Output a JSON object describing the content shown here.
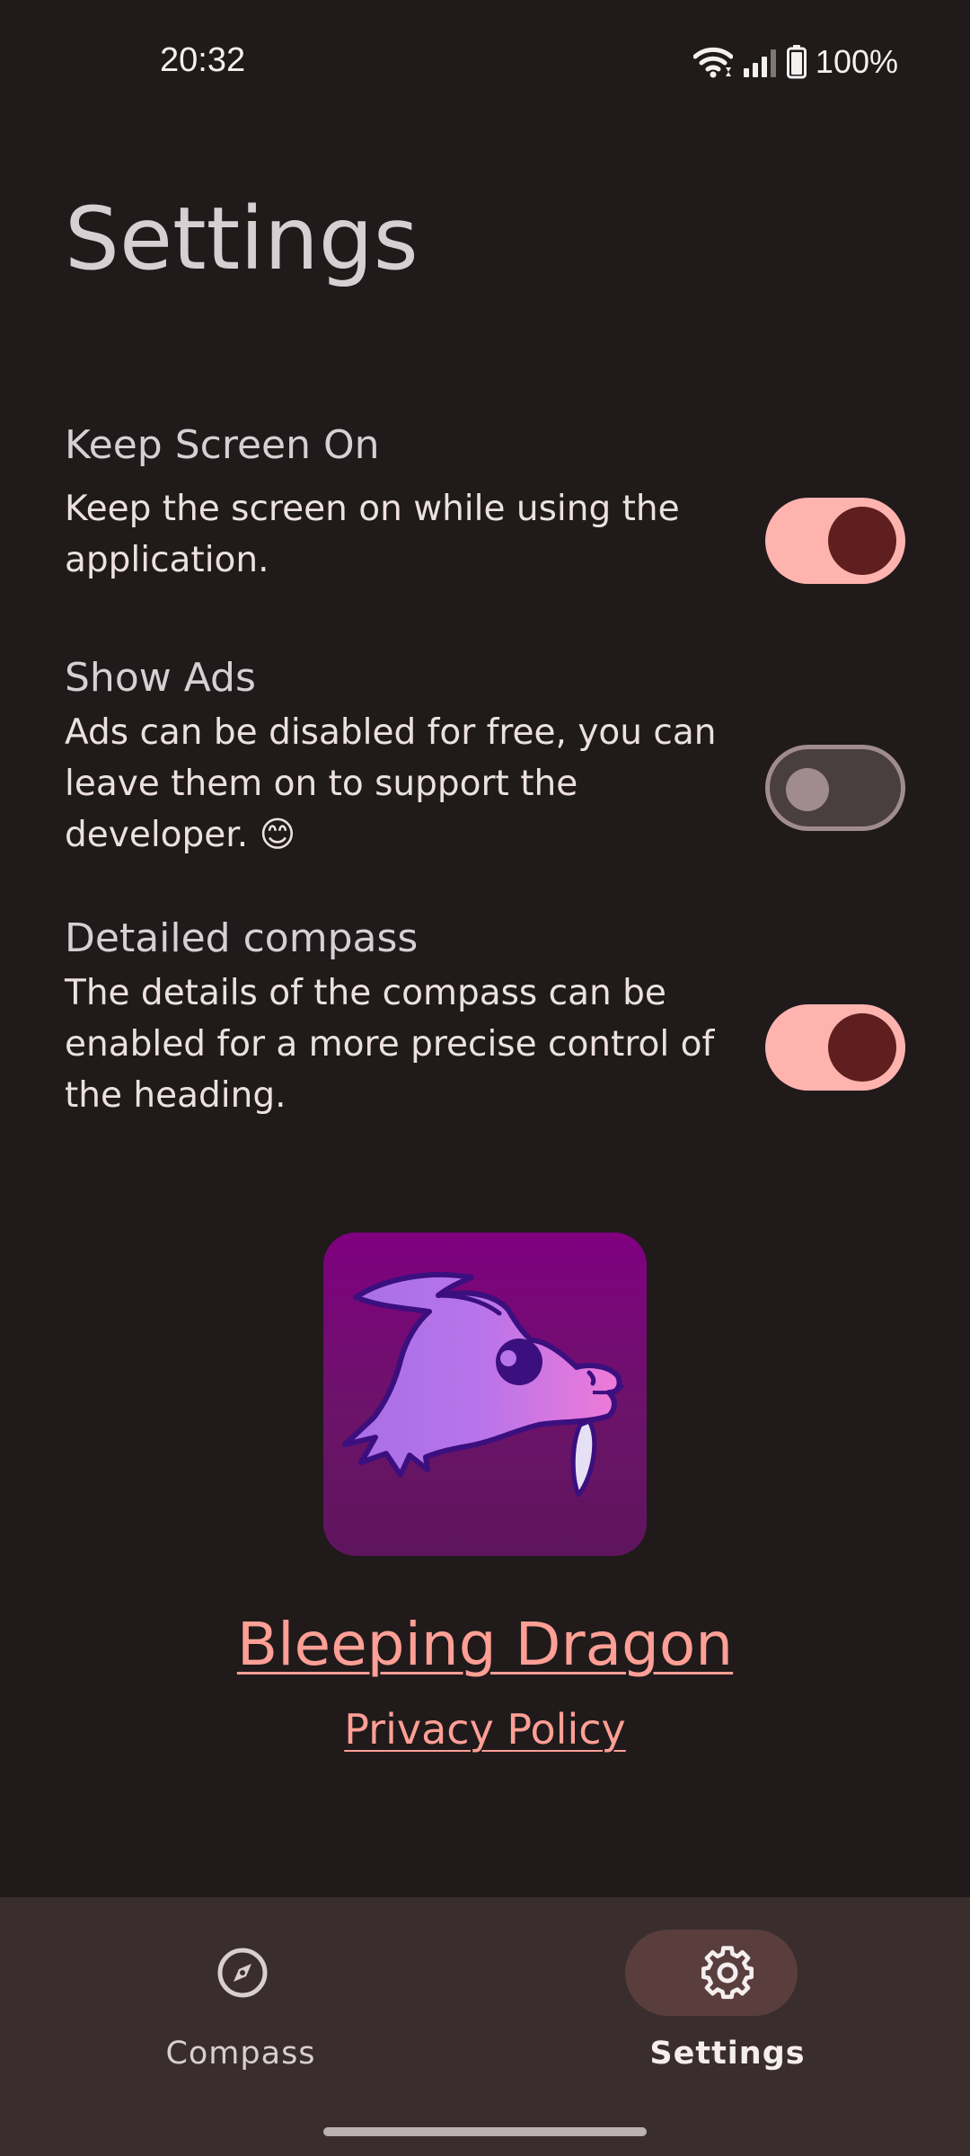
{
  "status_bar": {
    "time": "20:32",
    "battery": "100%",
    "icons": [
      "wifi-icon",
      "signal-icon",
      "battery-icon"
    ]
  },
  "page": {
    "title": "Settings"
  },
  "settings": [
    {
      "title": "Keep Screen On",
      "description": "Keep the screen on while using the application.",
      "enabled": true
    },
    {
      "title": "Show Ads",
      "description": "Ads can be disabled for free, you can leave them on to support the developer. 😊",
      "enabled": false
    },
    {
      "title": "Detailed compass",
      "description": "The details of the compass can be enabled for a more precise control of the heading.",
      "enabled": true
    }
  ],
  "about": {
    "logo_icon": "dragon-logo-icon",
    "developer_link": "Bleeping Dragon",
    "privacy_link": "Privacy Policy"
  },
  "bottom_nav": {
    "items": [
      {
        "label": "Compass",
        "icon": "compass-icon",
        "active": false
      },
      {
        "label": "Settings",
        "icon": "gear-icon",
        "active": true
      }
    ]
  },
  "colors": {
    "background": "#201a1b",
    "accent": "#ffb3ae",
    "link": "#ff9f95",
    "nav_background": "#3a2d2e"
  }
}
